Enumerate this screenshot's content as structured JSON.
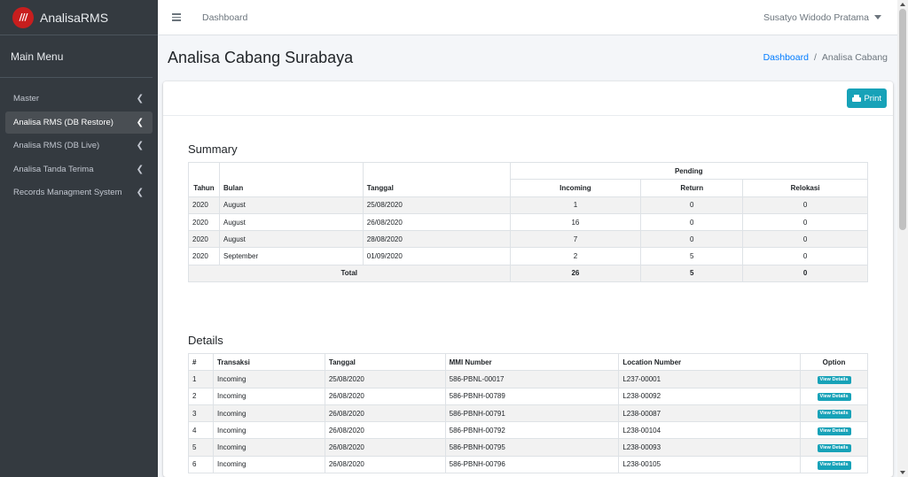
{
  "brand": {
    "logo_text": "///",
    "name": "AnalisaRMS"
  },
  "sidebar": {
    "header": "Main Menu",
    "items": [
      {
        "label": "Master",
        "active": false
      },
      {
        "label": "Analisa RMS (DB Restore)",
        "active": true
      },
      {
        "label": "Analisa RMS (DB Live)",
        "active": false
      },
      {
        "label": "Analisa Tanda Terima",
        "active": false
      },
      {
        "label": "Records Managment System",
        "active": false
      }
    ]
  },
  "topbar": {
    "link": "Dashboard",
    "user": "Susatyo Widodo Pratama"
  },
  "page": {
    "title": "Analisa Cabang Surabaya"
  },
  "breadcrumb": {
    "home": "Dashboard",
    "separator": "/",
    "current": "Analisa Cabang"
  },
  "card": {
    "print_label": "Print"
  },
  "summary": {
    "title": "Summary",
    "headers": {
      "tahun": "Tahun",
      "bulan": "Bulan",
      "tanggal": "Tanggal",
      "pending": "Pending",
      "incoming": "Incoming",
      "return": "Return",
      "relokasi": "Relokasi"
    },
    "rows": [
      {
        "tahun": "2020",
        "bulan": "August",
        "tanggal": "25/08/2020",
        "incoming": "1",
        "return": "0",
        "relokasi": "0"
      },
      {
        "tahun": "2020",
        "bulan": "August",
        "tanggal": "26/08/2020",
        "incoming": "16",
        "return": "0",
        "relokasi": "0"
      },
      {
        "tahun": "2020",
        "bulan": "August",
        "tanggal": "28/08/2020",
        "incoming": "7",
        "return": "0",
        "relokasi": "0"
      },
      {
        "tahun": "2020",
        "bulan": "September",
        "tanggal": "01/09/2020",
        "incoming": "2",
        "return": "5",
        "relokasi": "0"
      }
    ],
    "total": {
      "label": "Total",
      "incoming": "26",
      "return": "5",
      "relokasi": "0"
    }
  },
  "details": {
    "title": "Details",
    "headers": {
      "no": "#",
      "transaksi": "Transaksi",
      "tanggal": "Tanggal",
      "mmi": "MMI Number",
      "location": "Location Number",
      "option": "Option"
    },
    "view_label": "View Details",
    "rows": [
      {
        "no": "1",
        "transaksi": "Incoming",
        "tanggal": "25/08/2020",
        "mmi": "586-PBNL-00017",
        "location": "L237-00001"
      },
      {
        "no": "2",
        "transaksi": "Incoming",
        "tanggal": "26/08/2020",
        "mmi": "586-PBNH-00789",
        "location": "L238-00092"
      },
      {
        "no": "3",
        "transaksi": "Incoming",
        "tanggal": "26/08/2020",
        "mmi": "586-PBNH-00791",
        "location": "L238-00087"
      },
      {
        "no": "4",
        "transaksi": "Incoming",
        "tanggal": "26/08/2020",
        "mmi": "586-PBNH-00792",
        "location": "L238-00104"
      },
      {
        "no": "5",
        "transaksi": "Incoming",
        "tanggal": "26/08/2020",
        "mmi": "586-PBNH-00795",
        "location": "L238-00093"
      },
      {
        "no": "6",
        "transaksi": "Incoming",
        "tanggal": "26/08/2020",
        "mmi": "586-PBNH-00796",
        "location": "L238-00105"
      }
    ]
  }
}
